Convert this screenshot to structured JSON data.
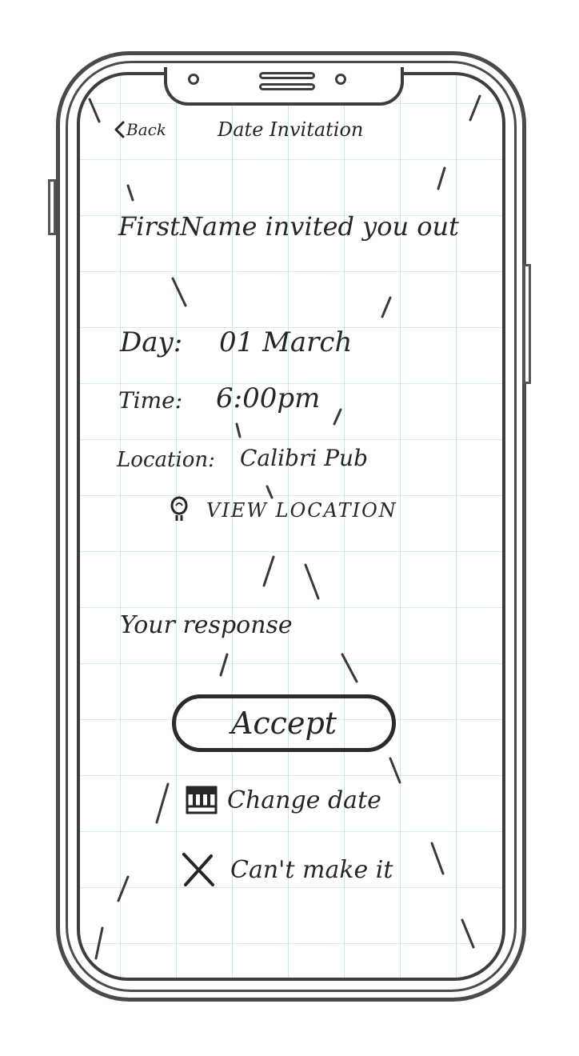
{
  "nav": {
    "back_label": "Back",
    "title": "Date Invitation"
  },
  "invite": {
    "headline": "FirstName invited you out"
  },
  "details": {
    "day_label": "Day:",
    "day_value": "01 March",
    "time_label": "Time:",
    "time_value": "6:00pm",
    "location_label": "Location:",
    "location_value": "Calibri Pub",
    "view_location_label": "VIEW LOCATION"
  },
  "response": {
    "heading": "Your response",
    "accept_label": "Accept",
    "change_date_label": "Change date",
    "cant_make_it_label": "Can't make it"
  },
  "icons": {
    "back": "chevron-left-icon",
    "view_location": "lightbulb-icon",
    "change_date": "calendar-icon",
    "cant_make_it": "close-icon"
  }
}
